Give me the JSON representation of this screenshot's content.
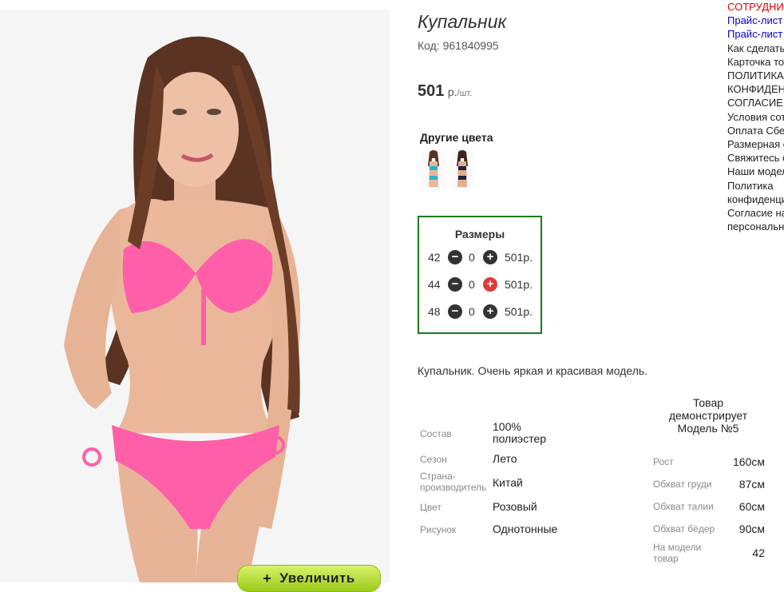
{
  "product": {
    "title": "Купальник",
    "code": "Код: 961840995",
    "price": "501",
    "price_unit": "р.",
    "price_per": "/шт.",
    "other_colors_label": "Другие цвета",
    "zoom_button": "Увеличить",
    "zoom_plus": "+",
    "description": "Купальник. Очень яркая и красивая модель."
  },
  "sizes": {
    "heading": "Размеры",
    "rows": [
      {
        "size": "42",
        "qty": "0",
        "price": "501р."
      },
      {
        "size": "44",
        "qty": "0",
        "price": "501р."
      },
      {
        "size": "48",
        "qty": "0",
        "price": "501р."
      }
    ],
    "minus_glyph": "−",
    "plus_glyph": "+"
  },
  "characteristics": [
    {
      "key": "Состав",
      "value": "100% полиэстер"
    },
    {
      "key": "Сезон",
      "value": "Лето"
    },
    {
      "key": "Страна-производитель",
      "value": "Китай"
    },
    {
      "key": "Цвет",
      "value": "Розовый"
    },
    {
      "key": "Рисунок",
      "value": "Однотонные"
    }
  ],
  "model": {
    "title": "Товар демонстрирует Модель №5",
    "rows": [
      {
        "key": "Рост",
        "value": "160см"
      },
      {
        "key": "Обхват груди",
        "value": "87см"
      },
      {
        "key": "Обхват талии",
        "value": "60см"
      },
      {
        "key": "Обхват бёдер",
        "value": "90см"
      },
      {
        "key": "На модели товар",
        "value": "42"
      }
    ]
  },
  "menu": [
    {
      "label": "СОТРУДНИЧЕСТВО",
      "color": "#e00000"
    },
    {
      "label": "Прайс-лист",
      "color": "#0000cc"
    },
    {
      "label": "Прайс-лист",
      "color": "#0000cc"
    },
    {
      "label": "Как сделать заказ",
      "color": "#222222"
    },
    {
      "label": "Карточка товара",
      "color": "#222222"
    },
    {
      "label": "ПОЛИТИКА",
      "color": "#222222"
    },
    {
      "label": "КОНФИДЕНЦИАЛЬНОСТИ",
      "color": "#222222"
    },
    {
      "label": "СОГЛАСИЕ",
      "color": "#222222"
    },
    {
      "label": "Условия сотрудничества",
      "color": "#222222"
    },
    {
      "label": "Оплата Сбербанк",
      "color": "#222222"
    },
    {
      "label": "Размерная сетка",
      "color": "#222222"
    },
    {
      "label": "Свяжитесь с нами",
      "color": "#222222"
    },
    {
      "label": "Наши модели",
      "color": "#222222"
    },
    {
      "label": "Политика",
      "color": "#222222"
    },
    {
      "label": "конфиденциальности",
      "color": "#222222"
    },
    {
      "label": "Согласие на обработку",
      "color": "#222222"
    },
    {
      "label": "персональных данных",
      "color": "#222222"
    }
  ],
  "colors": {
    "sizes_border": "#1a7d1a",
    "zoom_button": "#b5dc3a",
    "active_plus": "#e23a3a",
    "swimsuit": "#ff5fa8"
  }
}
